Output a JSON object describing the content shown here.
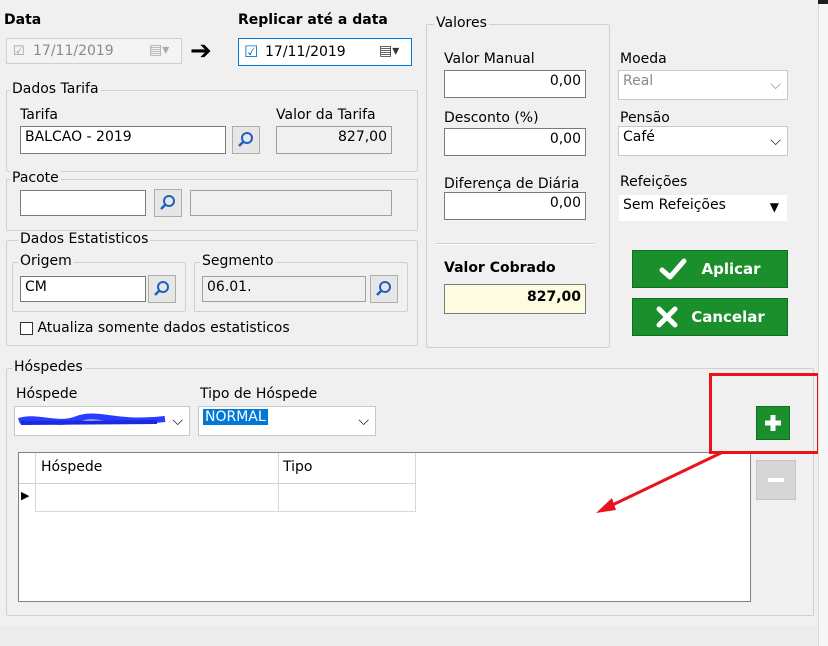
{
  "data_section": {
    "label": "Data",
    "date_value": "17/11/2019"
  },
  "replicar": {
    "label": "Replicar até a data",
    "date_value": "17/11/2019"
  },
  "dados_tarifa": {
    "title": "Dados Tarifa",
    "tarifa_label": "Tarifa",
    "tarifa_value": "BALCAO - 2019",
    "valor_label": "Valor da Tarifa",
    "valor_value": "827,00"
  },
  "pacote": {
    "title": "Pacote",
    "value": "",
    "desc": ""
  },
  "dados_estatisticos": {
    "title": "Dados Estatisticos",
    "origem_label": "Origem",
    "origem_value": "CM",
    "segmento_label": "Segmento",
    "segmento_value": "06.01.",
    "checkbox_label": "Atualiza somente dados estatisticos"
  },
  "valores": {
    "title": "Valores",
    "valor_manual_label": "Valor Manual",
    "valor_manual_value": "0,00",
    "desconto_label": "Desconto (%)",
    "desconto_value": "0,00",
    "diferenca_label": "Diferença de Diária",
    "diferenca_value": "0,00",
    "valor_cobrado_label": "Valor Cobrado",
    "valor_cobrado_value": "827,00"
  },
  "moeda": {
    "label": "Moeda",
    "value": "Real"
  },
  "pensao": {
    "label": "Pensão",
    "value": "Café"
  },
  "refeicoes": {
    "label": "Refeições",
    "value": "Sem Refeições"
  },
  "buttons": {
    "aplicar": "Aplicar",
    "cancelar": "Cancelar"
  },
  "hospedes": {
    "title": "Hóspedes",
    "hospede_label": "Hóspede",
    "tipo_label": "Tipo de Hóspede",
    "tipo_value": "NORMAL",
    "grid_columns": [
      "Hóspede",
      "Tipo"
    ]
  },
  "colors": {
    "green": "#1a8f2c",
    "highlight_red": "#e8141c",
    "selection_blue": "#0078d7",
    "valor_cobrado_bg": "#fdfbe0"
  },
  "icons": [
    "calendar-icon",
    "arrow-right-icon",
    "search-icon",
    "check-icon",
    "x-icon",
    "plus-icon",
    "minus-icon",
    "chevron-down-icon",
    "row-pointer-icon"
  ]
}
